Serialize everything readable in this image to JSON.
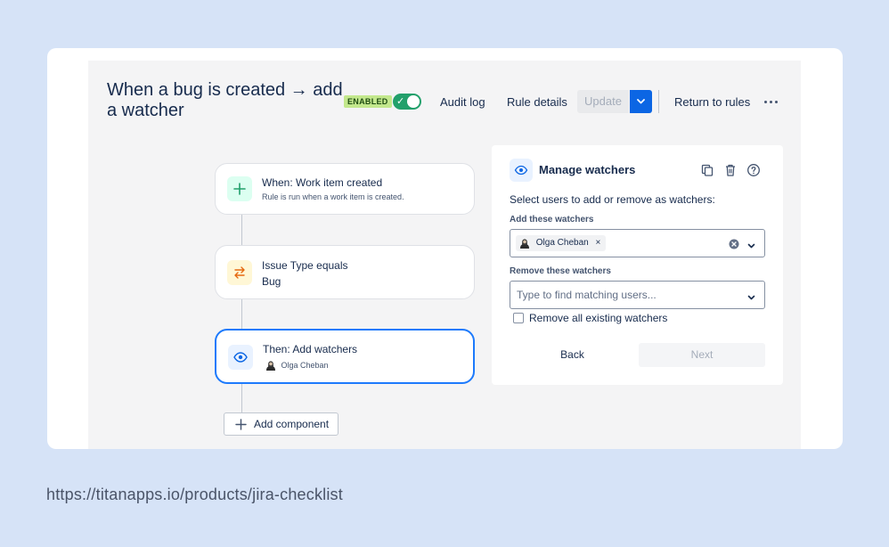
{
  "rule": {
    "title": "When a bug is created → add a watcher",
    "status_badge": "ENABLED",
    "enabled": true
  },
  "header": {
    "audit_log": "Audit log",
    "rule_details": "Rule details",
    "update": "Update",
    "return": "Return to rules"
  },
  "flow": {
    "trigger": {
      "title": "When: Work item created",
      "subtitle": "Rule is run when a work item is created."
    },
    "condition": {
      "title": "Issue Type equals",
      "value": "Bug"
    },
    "action": {
      "title": "Then: Add watchers",
      "user": "Olga Cheban"
    },
    "add_component": "Add component"
  },
  "panel": {
    "title": "Manage watchers",
    "instruction": "Select users to add or remove as watchers:",
    "add_label": "Add these watchers",
    "add_selected": "Olga Cheban",
    "remove_label": "Remove these watchers",
    "remove_placeholder": "Type to find matching users...",
    "remove_all_label": "Remove all existing watchers",
    "remove_all_checked": false,
    "back": "Back",
    "next": "Next"
  },
  "footer_url": "https://titanapps.io/products/jira-checklist",
  "colors": {
    "page_bg": "#d6e3f7",
    "accent": "#0c66e4",
    "toggle": "#22a06b",
    "badge": "#c3e88d",
    "selected_border": "#1d7afc"
  },
  "icons": [
    "check-icon",
    "chevron-down-icon",
    "more-icon",
    "plus-icon",
    "swap-icon",
    "eye-icon",
    "copy-icon",
    "trash-icon",
    "help-icon",
    "clear-icon",
    "close-icon",
    "user-avatar-icon"
  ]
}
